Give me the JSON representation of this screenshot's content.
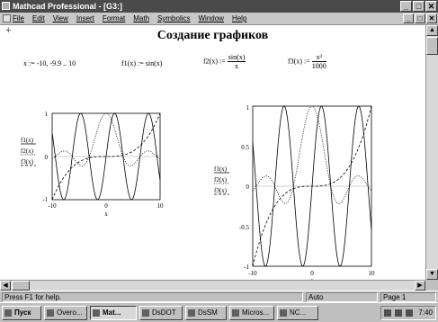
{
  "window": {
    "title": "Mathcad Professional - [G3:]",
    "minimize": "_",
    "maximize": "□",
    "close": "✕"
  },
  "menu": {
    "items": [
      "File",
      "Edit",
      "View",
      "Insert",
      "Format",
      "Math",
      "Symbolics",
      "Window",
      "Help"
    ]
  },
  "document": {
    "heading": "Создание графиков",
    "range_def": "x := -10, -9.9 .. 10",
    "f1_def_lhs": "f1(x)",
    "f1_def_rhs": ":= sin(x)",
    "f2_def_lhs": "f2(x) :=",
    "f2_num": "sin(x)",
    "f2_den": "x",
    "f3_def_lhs": "f3(x) :=",
    "f3_num": "x³",
    "f3_den": "1000"
  },
  "chart_data": [
    {
      "type": "line",
      "series": [
        {
          "name": "f1(x)",
          "function": "sin(x)",
          "style": "solid",
          "color": "#000000"
        },
        {
          "name": "f2(x)",
          "function": "sin(x)/x",
          "style": "dotted",
          "color": "#000000"
        },
        {
          "name": "f3(x)",
          "function": "x^3/1000",
          "style": "dashed",
          "color": "#000000"
        }
      ],
      "xlim": [
        -10,
        10
      ],
      "ylim": [
        -1,
        1
      ],
      "xticks": [
        "-10",
        "0",
        "10"
      ],
      "yticks": [
        "1",
        "0",
        "-1"
      ],
      "xlabel": "x",
      "legend": [
        "f1(x)",
        "f2(x)",
        "f3(x)"
      ]
    },
    {
      "type": "line",
      "series": [
        {
          "name": "f1(x)",
          "function": "sin(x)",
          "style": "solid",
          "color": "#000000"
        },
        {
          "name": "f2(x)",
          "function": "sin(x)/x",
          "style": "dotted",
          "color": "#000000"
        },
        {
          "name": "f3(x)",
          "function": "x^3/1000",
          "style": "dashed",
          "color": "#000000"
        }
      ],
      "xlim": [
        -10,
        10
      ],
      "ylim": [
        -1,
        1
      ],
      "xticks": [
        "-10",
        "0",
        "10"
      ],
      "yticks": [
        "1",
        "0.5",
        "0",
        "-0.5",
        "-1"
      ],
      "xlabel": "x",
      "legend": [
        "f1(x)",
        "f2(x)",
        "f3(x)"
      ]
    }
  ],
  "statusbar": {
    "help": "Press F1 for help.",
    "mode": "Auto",
    "page": "Page 1"
  },
  "taskbar": {
    "items": [
      "Пуск",
      "Overo...",
      "Mat...",
      "DsDOT",
      "DsSM",
      "Micros...",
      "NC..."
    ],
    "clock": "7:40"
  }
}
